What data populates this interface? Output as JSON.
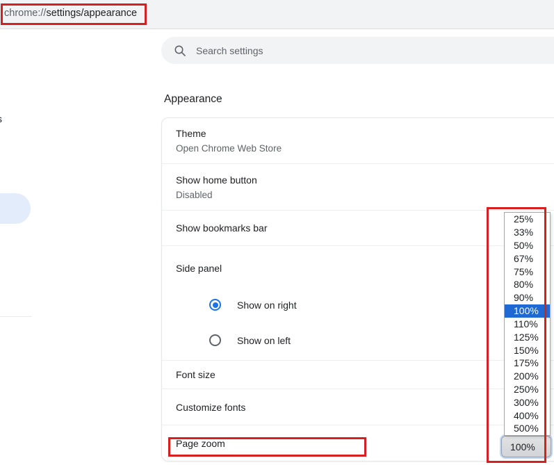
{
  "omnibox": {
    "url_scheme": "chrome://",
    "url_rest": "settings/appearance",
    "full_url": "chrome://settings/appearance"
  },
  "search": {
    "placeholder": "Search settings"
  },
  "sidebar": {
    "selected_item_fragment": "s"
  },
  "page": {
    "heading": "Appearance"
  },
  "settings": {
    "theme": {
      "label": "Theme",
      "sublabel": "Open Chrome Web Store"
    },
    "home_button": {
      "label": "Show home button",
      "sublabel": "Disabled"
    },
    "bookmarks_bar": {
      "label": "Show bookmarks bar"
    },
    "side_panel": {
      "label": "Side panel",
      "options": [
        {
          "label": "Show on right",
          "selected": true
        },
        {
          "label": "Show on left",
          "selected": false
        }
      ]
    },
    "font_size": {
      "label": "Font size"
    },
    "customize_fonts": {
      "label": "Customize fonts"
    },
    "page_zoom": {
      "label": "Page zoom",
      "value": "100%"
    }
  },
  "zoom_menu": {
    "options": [
      "25%",
      "33%",
      "50%",
      "67%",
      "75%",
      "80%",
      "90%",
      "100%",
      "110%",
      "125%",
      "150%",
      "175%",
      "200%",
      "250%",
      "300%",
      "400%",
      "500%"
    ],
    "selected": "100%"
  },
  "colors": {
    "annotation_red": "#d61f1f",
    "menu_highlight_blue": "#1e69d2",
    "radio_blue": "#1a73e8",
    "selected_pill_blue": "#e3ecfa",
    "toolbar_gray": "#f1f3f4"
  }
}
